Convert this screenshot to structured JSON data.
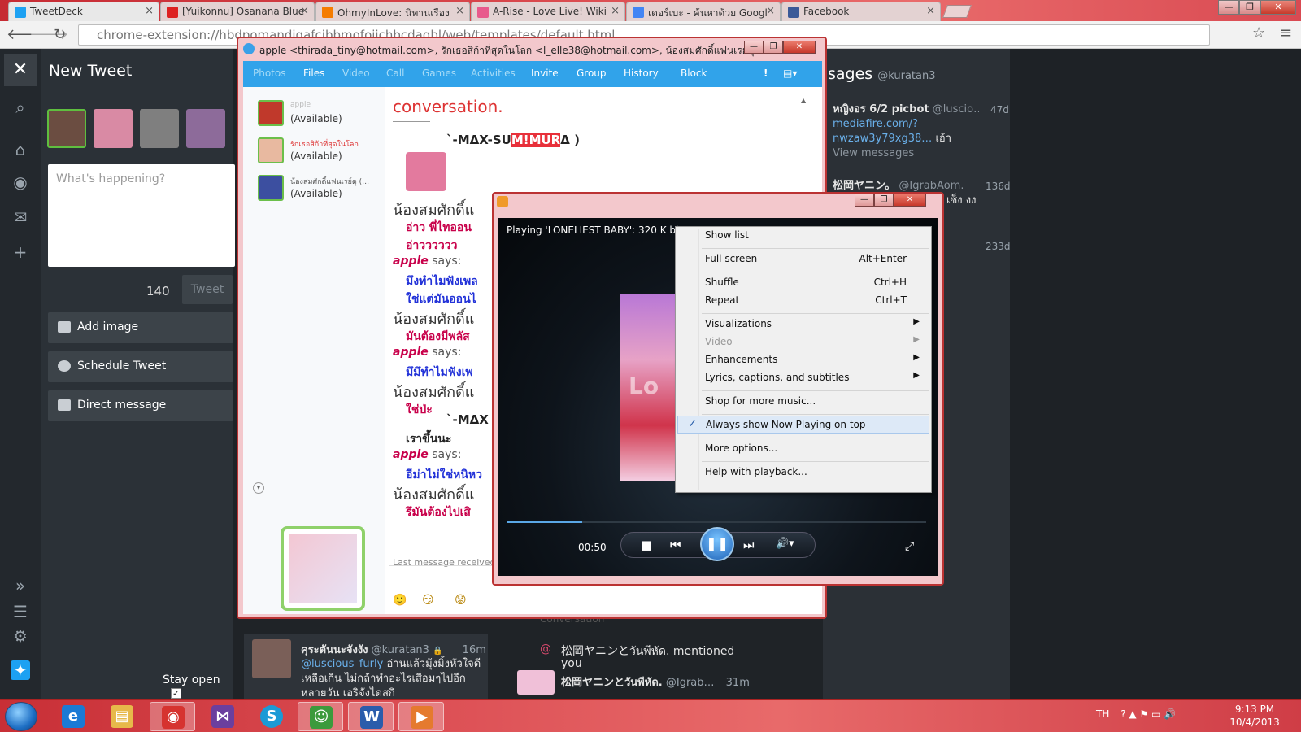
{
  "browser": {
    "tabs": [
      {
        "label": "TweetDeck",
        "color": "#1da1f2"
      },
      {
        "label": "[Yuikonnu] Osanana Blue",
        "color": "#d22"
      },
      {
        "label": "OhmyInLove: นิทานเรือง",
        "color": "#f57c00"
      },
      {
        "label": "A-Rise - Love Live! Wiki",
        "color": "#e85a8c"
      },
      {
        "label": "เดอร์เบะ - ค้นหาด้วย Googl",
        "color": "#4285f4"
      },
      {
        "label": "Facebook",
        "color": "#3b5998"
      }
    ],
    "tab_close": "×",
    "address": "chrome-extension://hbdpomandigafcibbmofojjchbcdagbl/web/templates/default.html",
    "back_glyph": "🡐",
    "forward_glyph": "🡒",
    "reload_glyph": "↻",
    "star_glyph": "☆",
    "menu_glyph": "≡",
    "window_buttons": {
      "min": "—",
      "max": "❐",
      "close": "✕"
    }
  },
  "tweetdeck": {
    "nav_icons": [
      "close-icon",
      "search-icon",
      "home-icon",
      "mentions-icon",
      "messages-icon",
      "add-column-icon",
      "expand-icon",
      "columns-icon",
      "settings-icon",
      "twitter-icon"
    ],
    "compose_title": "New Tweet",
    "placeholder": "What's happening?",
    "char_count": "140",
    "tweet_button": "Tweet",
    "actions": [
      "Add image",
      "Schedule Tweet",
      "Direct message"
    ],
    "stay_open": "Stay open",
    "stay_open_mark": "✓",
    "messages_title": "sages",
    "messages_handle": "@kuratan3",
    "messages": [
      {
        "name": "หญิงอร 6/2 picbot",
        "handle": "@luscio…",
        "time": "47d",
        "text": [
          "mediafire.com/?",
          "nwzaw3y79xg38…"
        ],
        "suffix": "เอ้า",
        "footer": "View messages"
      },
      {
        "name": "松岡ヤニン。",
        "handle": "@IgrabAom…",
        "time": "136d",
        "text": "เซ็ง งง"
      },
      {
        "time": "233d"
      }
    ],
    "bottom_tweet": {
      "name": "คุระตันนะจังงัง",
      "handle": "@kuratan3",
      "lock": "🔒",
      "time": "16m",
      "mention": "@luscious_furly",
      "body": "อ่านแล้วมุ้งมิ้งหัวใจดีเหลือเกิน ไม่กล้าทำอะไรเสื่อมๆไปอีกหลายวัน เอริจังไดสกิ"
    },
    "bottom_col2": {
      "icon": "@",
      "line1": "松岡ヤニンとวันพีหัด. mentioned",
      "line2": "you",
      "line3_name": "松岡ヤニンとวันพีหัด.",
      "line3_handle": "@Igrab…",
      "line3_time": "31m",
      "faded": "Conversation"
    }
  },
  "chat": {
    "title": "apple  <thirada_tiny@hotmail.com>, รักเธอสิก้าที่สุดในโลก <l_elle38@hotmail.com>, น้องสมศักดิ์แฟนเรย์ตุ...",
    "menu": [
      "Photos",
      "Files",
      "Video",
      "Call",
      "Games",
      "Activities",
      "Invite",
      "Group",
      "History",
      "Block"
    ],
    "menu_dim": [
      true,
      false,
      true,
      true,
      true,
      true,
      false,
      false,
      false,
      false
    ],
    "menu_extra": "!",
    "contacts": [
      {
        "name": "apple",
        "status": "(Available)"
      },
      {
        "name": "รักเธอสิก้าที่สุดในโลก",
        "status": "(Available)"
      },
      {
        "name": "น้องสมศักดิ์แฟนเรย์ตุ (…",
        "status": "(Available)"
      }
    ],
    "conversation_title": "conversation.",
    "sender_header": "`-MΔX-SU",
    "sender_header_hl": "M!MUR",
    "sender_header_end": "Δ )",
    "lines": [
      {
        "type": "name",
        "text": "น้องสมศักดิ์แ"
      },
      {
        "type": "red",
        "text": "อ่าว พี่ไทออน"
      },
      {
        "type": "red",
        "text": "อ่าวววววว"
      },
      {
        "type": "says",
        "who": "apple",
        "text": "says:"
      },
      {
        "type": "blue",
        "text": "มึงทำไมฟังเพล"
      },
      {
        "type": "blue",
        "text": "ใช่แต่มันออนไ"
      },
      {
        "type": "name",
        "text": "น้องสมศักดิ์แ"
      },
      {
        "type": "red",
        "text": "มันต้องมีพลัส"
      },
      {
        "type": "says",
        "who": "apple",
        "text": "says:"
      },
      {
        "type": "blue",
        "text": "มึมึทำไมฟังเพ"
      },
      {
        "type": "name",
        "text": "น้องสมศักดิ์แ"
      },
      {
        "type": "red",
        "text": "ใช่ป่ะ"
      },
      {
        "type": "sub",
        "text": "`-MΔX"
      },
      {
        "type": "black",
        "text": "เราขึ้นนะ"
      },
      {
        "type": "says",
        "who": "apple",
        "text": "says:"
      },
      {
        "type": "blue",
        "text": "อีม่าไม่ใช่หนิหว"
      },
      {
        "type": "name",
        "text": "น้องสมศักดิ์แ"
      },
      {
        "type": "red",
        "text": "รึมันต้องไปเสิ"
      }
    ],
    "last_message": "Last message received",
    "emoji": [
      "🙂",
      "😏",
      "😟"
    ],
    "collapse_glyph": "▾",
    "scroll_up_glyph": "▲"
  },
  "player": {
    "status": "Playing 'LONELIEST BABY': 320 K bits/se",
    "time": "00:50",
    "progress": 0.18,
    "controls": {
      "stop": "■",
      "prev": "⏮",
      "play": "❚❚",
      "next": "⏭",
      "volume": "🔊▾",
      "fullscreen": "⤢"
    },
    "art_text": "Lo"
  },
  "context_menu": {
    "items": [
      {
        "label": "Show list"
      },
      {
        "label": "Full screen",
        "shortcut": "Alt+Enter"
      },
      {
        "label": "Shuffle",
        "shortcut": "Ctrl+H"
      },
      {
        "label": "Repeat",
        "shortcut": "Ctrl+T"
      },
      {
        "label": "Visualizations",
        "sub": true
      },
      {
        "label": "Video",
        "sub": true,
        "disabled": true
      },
      {
        "label": "Enhancements",
        "sub": true
      },
      {
        "label": "Lyrics, captions, and subtitles",
        "sub": true
      },
      {
        "label": "Shop for more music..."
      },
      {
        "label": "Always show Now Playing on top",
        "checked": true
      },
      {
        "label": "More options..."
      },
      {
        "label": "Help with playback..."
      }
    ],
    "check_glyph": "✓",
    "arrow_glyph": "▶"
  },
  "taskbar": {
    "lang": "TH",
    "time": "9:13 PM",
    "date": "10/4/2013",
    "apps": [
      {
        "name": "internet-explorer",
        "glyph": "e",
        "color": "#1b7ad4"
      },
      {
        "name": "file-explorer",
        "glyph": "▤",
        "color": "#e7b94a"
      },
      {
        "name": "chrome",
        "glyph": "◉",
        "color": "#d6332f"
      },
      {
        "name": "visual-studio",
        "glyph": "⋈",
        "color": "#6b3f9e"
      },
      {
        "name": "skype",
        "glyph": "S",
        "color": "#1b9ad6"
      },
      {
        "name": "messenger",
        "glyph": "☺",
        "color": "#3c9a3c"
      },
      {
        "name": "word",
        "glyph": "W",
        "color": "#2b5cab"
      },
      {
        "name": "media-player",
        "glyph": "▶",
        "color": "#e57a2e"
      }
    ],
    "tray_icons": "?  ▲  ⚑  ▭  🔊"
  }
}
